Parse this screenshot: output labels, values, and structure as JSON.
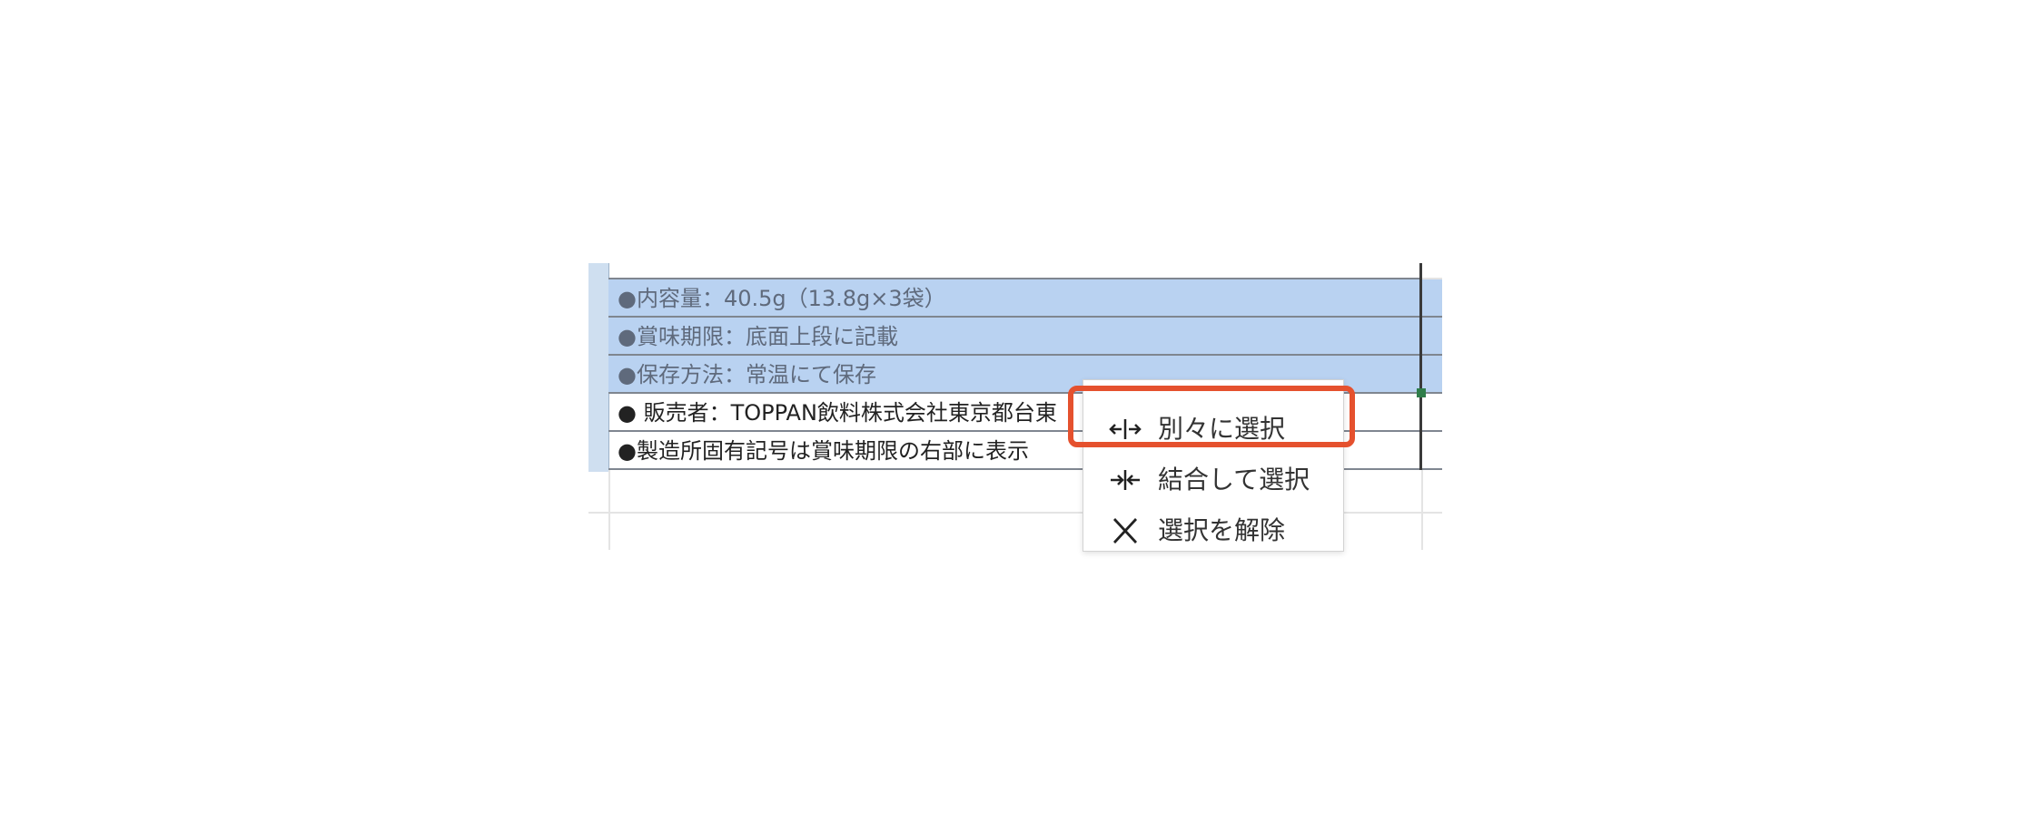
{
  "sheet": {
    "rows": [
      {
        "text": "●内容量：40.5g（13.8g×3袋）",
        "selected": true
      },
      {
        "text": "●賞味期限：底面上段に記載",
        "selected": true
      },
      {
        "text": "●保存方法：常温にて保存",
        "selected": true
      },
      {
        "text": "● 販売者：TOPPAN飲料株式会社東京都台東",
        "selected": false
      },
      {
        "text": "●製造所固有記号は賞味期限の右部に表示",
        "selected": false
      }
    ]
  },
  "context_menu": {
    "items": [
      {
        "label": "別々に選択",
        "icon": "split-arrows-icon",
        "highlighted": true
      },
      {
        "label": "結合して選択",
        "icon": "merge-arrows-icon",
        "highlighted": false
      },
      {
        "label": "選択を解除",
        "icon": "close-icon",
        "highlighted": false
      }
    ]
  },
  "colors": {
    "selection": "#b9d2f1",
    "highlight_border": "#e5512e",
    "fill_handle": "#2f7d4a"
  }
}
